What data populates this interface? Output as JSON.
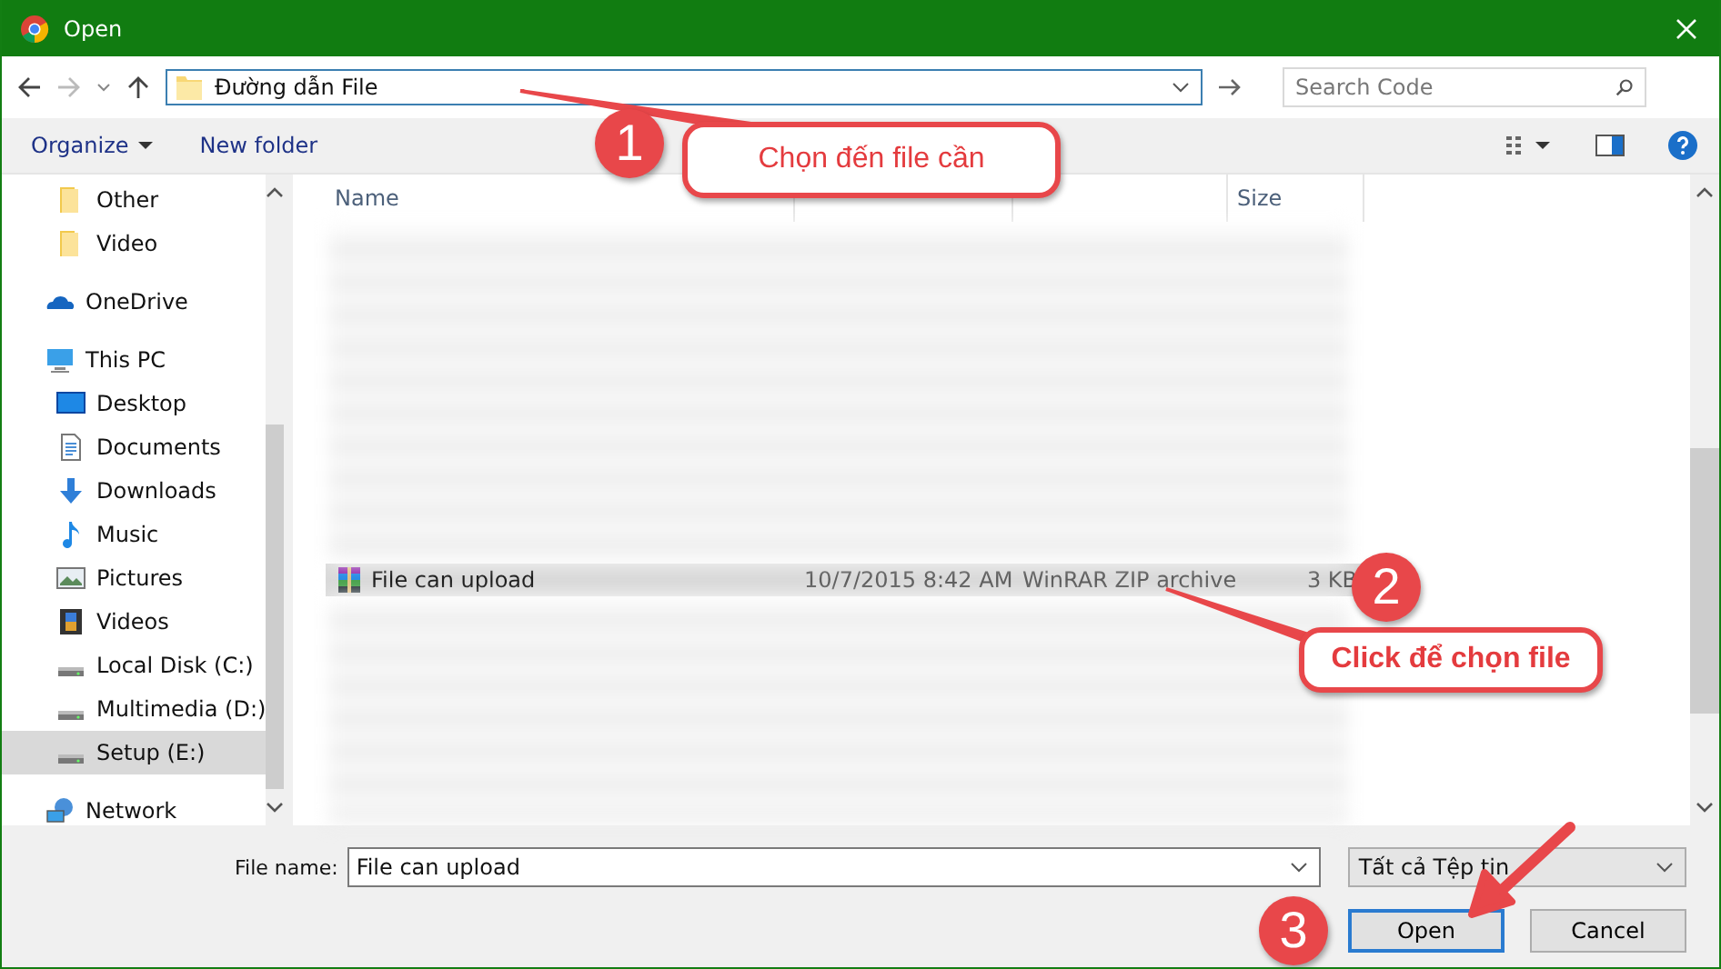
{
  "window": {
    "title": "Open"
  },
  "nav": {
    "path": "Đường dẫn File",
    "search_placeholder": "Search Code"
  },
  "toolbar": {
    "organize": "Organize",
    "new_folder": "New folder"
  },
  "sidebar": {
    "items": [
      {
        "children": [
          {
            "label": "Other",
            "kind": "folder",
            "selected": false
          },
          {
            "label": "Video",
            "kind": "folder",
            "selected": false
          }
        ]
      },
      {
        "label": "OneDrive",
        "kind": "cloud",
        "selected": false
      },
      {
        "label": "This PC",
        "kind": "pc",
        "selected": false,
        "children": [
          {
            "label": "Desktop",
            "kind": "desktop",
            "selected": false
          },
          {
            "label": "Documents",
            "kind": "document",
            "selected": false
          },
          {
            "label": "Downloads",
            "kind": "download",
            "selected": false
          },
          {
            "label": "Music",
            "kind": "music",
            "selected": false
          },
          {
            "label": "Pictures",
            "kind": "pictures",
            "selected": false
          },
          {
            "label": "Videos",
            "kind": "film",
            "selected": false
          },
          {
            "label": "Local Disk (C:)",
            "kind": "drive",
            "selected": false
          },
          {
            "label": "Multimedia (D:)",
            "kind": "drive",
            "selected": false
          },
          {
            "label": "Setup (E:)",
            "kind": "drive",
            "selected": true
          }
        ]
      },
      {
        "label": "Network",
        "kind": "network",
        "selected": false
      }
    ]
  },
  "file_list": {
    "columns": [
      "Name",
      "",
      "",
      "Size"
    ],
    "rows": [
      {
        "name": "File can upload",
        "date": "10/7/2015 8:42 AM",
        "type": "WinRAR ZIP archive",
        "size": "3 KB",
        "selected": true
      }
    ]
  },
  "bottom": {
    "file_name_label": "File name:",
    "file_name": "File can upload",
    "filter": "Tất cả Tệp tin",
    "buttons": [
      "Open",
      "Cancel"
    ]
  },
  "annotations": [
    {
      "number": "1",
      "text": "Chọn đến file cần"
    },
    {
      "number": "2",
      "text": "Click để chọn file"
    },
    {
      "number": "3"
    }
  ]
}
